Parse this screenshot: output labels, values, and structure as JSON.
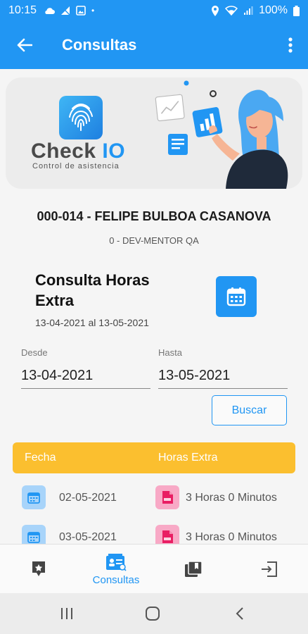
{
  "status_bar": {
    "time": "10:15",
    "battery": "100%",
    "dot": "•"
  },
  "app_bar": {
    "title": "Consultas"
  },
  "banner": {
    "brand_main": "Check",
    "brand_accent": "IO",
    "brand_sub": "Control de asistencia"
  },
  "employee": {
    "name": "000-014 - FELIPE BULBOA CASANOVA",
    "department": "0 - DEV-MENTOR QA"
  },
  "section": {
    "title": "Consulta Horas Extra",
    "range": "13-04-2021 al 13-05-2021"
  },
  "filters": {
    "desde_label": "Desde",
    "desde_value": "13-04-2021",
    "hasta_label": "Hasta",
    "hasta_value": "13-05-2021",
    "search_label": "Buscar"
  },
  "table": {
    "headers": [
      "Fecha",
      "Horas Extra"
    ],
    "rows": [
      {
        "date": "02-05-2021",
        "hours": "3 Horas 0 Minutos"
      },
      {
        "date": "03-05-2021",
        "hours": "3 Horas 0 Minutos"
      }
    ]
  },
  "bottom_nav": {
    "items": [
      {
        "label": ""
      },
      {
        "label": "Consultas"
      },
      {
        "label": ""
      },
      {
        "label": ""
      }
    ]
  },
  "colors": {
    "primary": "#2196f3",
    "accent": "#fbbf2f",
    "date_icon_bg": "#a8d4fa",
    "pdf_icon_bg": "#f8a9c6"
  },
  "icons": {
    "status_left": [
      "cloud-icon",
      "signal-off-icon",
      "image-icon"
    ],
    "status_right": [
      "location-icon",
      "wifi-icon",
      "signal-icon",
      "battery-icon"
    ],
    "app_bar": [
      "back-arrow-icon",
      "more-vert-icon"
    ],
    "bottom_nav": [
      "star-note-icon",
      "contact-card-icon",
      "library-icon",
      "logout-icon"
    ],
    "system_nav": [
      "recents-icon",
      "home-icon",
      "back-icon"
    ]
  }
}
